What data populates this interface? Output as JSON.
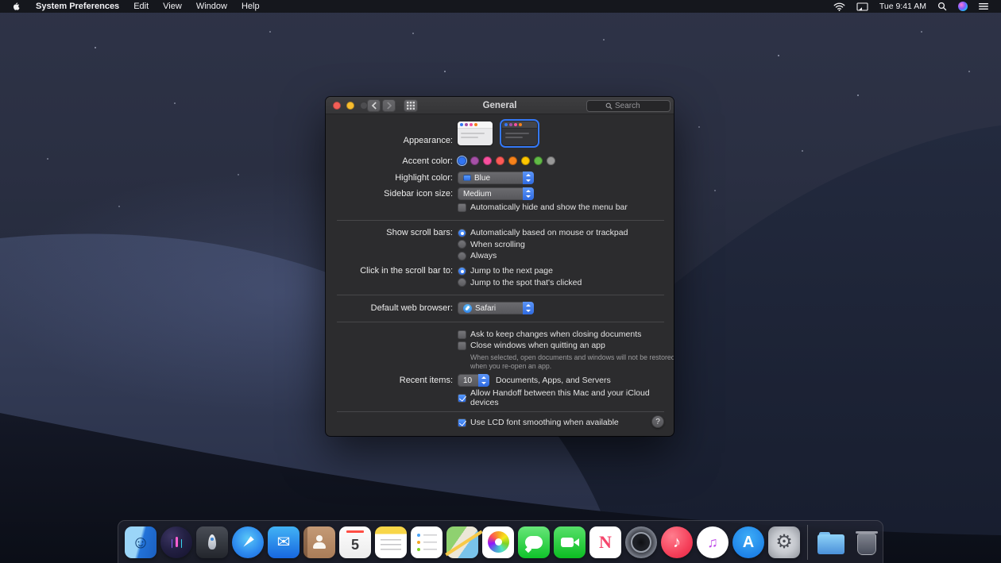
{
  "menu_bar": {
    "menus": [
      {
        "name": "menu-system-preferences",
        "label": "System Preferences",
        "class": "bold"
      },
      {
        "name": "menu-edit",
        "label": "Edit"
      },
      {
        "name": "menu-view",
        "label": "View"
      },
      {
        "name": "menu-window",
        "label": "Window"
      },
      {
        "name": "menu-help",
        "label": "Help"
      }
    ],
    "clock": "Tue 9:41 AM"
  },
  "window": {
    "title": "General",
    "search_placeholder": "Search",
    "rows": {
      "appearance": {
        "label": "Appearance:",
        "selected": "Dark"
      },
      "accent": {
        "label": "Accent color:",
        "selected": "Blue",
        "colors": [
          {
            "name": "accent-color-blue",
            "hex": "#3174f1",
            "state": "sel"
          },
          {
            "name": "accent-color-purple",
            "hex": "#a550a7",
            "state": ""
          },
          {
            "name": "accent-color-pink",
            "hex": "#f74f9e",
            "state": ""
          },
          {
            "name": "accent-color-red",
            "hex": "#fc5a57",
            "state": ""
          },
          {
            "name": "accent-color-orange",
            "hex": "#f7821b",
            "state": ""
          },
          {
            "name": "accent-color-yellow",
            "hex": "#fec600",
            "state": ""
          },
          {
            "name": "accent-color-green",
            "hex": "#61ba46",
            "state": ""
          },
          {
            "name": "accent-color-graphite",
            "hex": "#989898",
            "state": ""
          }
        ]
      },
      "highlight": {
        "label": "Highlight color:",
        "value": "Blue"
      },
      "sidebar_size": {
        "label": "Sidebar icon size:",
        "value": "Medium"
      },
      "hide_menu_bar": {
        "label": "Automatically hide and show the menu bar",
        "checked": false
      },
      "scroll_bars": {
        "label": "Show scroll bars:",
        "options": [
          {
            "name": "radio-scrollbars-automatic",
            "label": "Automatically based on mouse or trackpad",
            "state": "on"
          },
          {
            "name": "radio-scrollbars-when-scrolling",
            "label": "When scrolling",
            "state": ""
          },
          {
            "name": "radio-scrollbars-always",
            "label": "Always",
            "state": ""
          }
        ]
      },
      "click_scroll": {
        "label": "Click in the scroll bar to:",
        "options": [
          {
            "name": "radio-jump-next-page",
            "label": "Jump to the next page",
            "state": "on"
          },
          {
            "name": "radio-jump-to-spot",
            "label": "Jump to the spot that's clicked",
            "state": ""
          }
        ]
      },
      "browser": {
        "label": "Default web browser:",
        "value": "Safari"
      },
      "ask_keep": {
        "label": "Ask to keep changes when closing documents",
        "checked": false
      },
      "close_windows": {
        "label": "Close windows when quitting an app",
        "checked": false
      },
      "note": "When selected, open documents and windows will not be restored when you re-open an app.",
      "recent": {
        "label": "Recent items:",
        "value": "10",
        "suffix": "Documents, Apps, and Servers"
      },
      "handoff": {
        "label": "Allow Handoff between this Mac and your iCloud devices",
        "checked": true
      },
      "lcd": {
        "label": "Use LCD font smoothing when available",
        "checked": true
      }
    },
    "help_label": "?"
  },
  "dock": {
    "apps": [
      {
        "name": "dock-finder-icon",
        "tile_class": "",
        "bg": "linear-gradient(105deg,#9bd5f8 0%,#9bd5f8 46%,#2272d8 54%,#1b5fc0 100%)",
        "glyph": "☺",
        "fg": "#0d3a70",
        "glyph_class": "g22"
      },
      {
        "name": "dock-siri-icon",
        "tile_class": "circle",
        "bg": "radial-gradient(circle at 35% 30%,#3c3562 0%,#232043 45%,#14122c 100%)",
        "glyph": "",
        "fg": "",
        "glyph_class": "siri-wave"
      },
      {
        "name": "dock-launchpad-icon",
        "tile_class": "",
        "bg": "linear-gradient(180deg,#494d56,#23262c)",
        "glyph": "",
        "fg": "",
        "glyph_class": "rocket"
      },
      {
        "name": "dock-safari-icon",
        "tile_class": "circle",
        "bg": "radial-gradient(circle at 50% 38%,#5bc8f7 0%,#2f8df0 55%,#1763d8 100%)",
        "glyph": "",
        "fg": "",
        "glyph_class": "needle"
      },
      {
        "name": "dock-mail-icon",
        "tile_class": "",
        "bg": "linear-gradient(180deg,#42b3f5,#1767e0)",
        "glyph": "✉",
        "fg": "#ffffff",
        "glyph_class": "g20"
      },
      {
        "name": "dock-contacts-icon",
        "tile_class": "book",
        "bg": "linear-gradient(180deg,#c49a76,#a97c58)",
        "glyph": "",
        "fg": "",
        "glyph_class": "person"
      },
      {
        "name": "dock-calendar-icon",
        "tile_class": "cal",
        "bg": "linear-gradient(180deg,#fdfdfd,#ececec)",
        "glyph": "5",
        "fg": "#3a3a3c",
        "glyph_class": "g18 cal-num"
      },
      {
        "name": "dock-notes-icon",
        "tile_class": "notes",
        "bg": "linear-gradient(180deg,#f8d648 0%,#f8d648 24%,#ffffff 24%)",
        "glyph": "",
        "fg": "",
        "glyph_class": ""
      },
      {
        "name": "dock-reminders-icon",
        "tile_class": "rem",
        "bg": "#ffffff",
        "glyph": "",
        "fg": "",
        "glyph_class": ""
      },
      {
        "name": "dock-maps-icon",
        "tile_class": "maps",
        "bg": "linear-gradient(125deg,#8fd170 0%,#8fd170 38%,#ece7d8 38%,#ece7d8 62%,#79c3ea 62%)",
        "glyph": "",
        "fg": "",
        "glyph_class": ""
      },
      {
        "name": "dock-photos-icon",
        "tile_class": "photos",
        "bg": "#ffffff",
        "glyph": "",
        "fg": "",
        "glyph_class": ""
      },
      {
        "name": "dock-messages-icon",
        "tile_class": "msg",
        "bg": "linear-gradient(180deg,#67e679,#0fc32a)",
        "glyph": "",
        "fg": "",
        "glyph_class": ""
      },
      {
        "name": "dock-facetime-icon",
        "tile_class": "ft",
        "bg": "linear-gradient(180deg,#57e06a,#0cbd22)",
        "glyph": "",
        "fg": "",
        "glyph_class": ""
      },
      {
        "name": "dock-news-icon",
        "tile_class": "",
        "bg": "#ffffff",
        "glyph": "N",
        "fg": "#f5446b",
        "glyph_class": "g22 serif"
      },
      {
        "name": "dock-photo-booth-icon",
        "tile_class": "circle lens",
        "bg": "radial-gradient(circle,#0e0f13 0%,#23252c 35%,#7d828e 70%,#41454e 100%)",
        "glyph": "",
        "fg": "",
        "glyph_class": ""
      },
      {
        "name": "dock-music-icon",
        "tile_class": "circle",
        "bg": "radial-gradient(circle at 35% 30%,#ff7d8e,#f5405a 60%,#e02440)",
        "glyph": "♪",
        "fg": "#ffffff",
        "glyph_class": "g20"
      },
      {
        "name": "dock-itunes-icon",
        "tile_class": "circle",
        "bg": "#ffffff",
        "glyph": "♫",
        "fg": "#c050e8",
        "glyph_class": "g18"
      },
      {
        "name": "dock-app-store-icon",
        "tile_class": "circle",
        "bg": "radial-gradient(circle at 50% 35%,#3eaef7,#1272e2)",
        "glyph": "A",
        "fg": "#ffffff",
        "glyph_class": "g20 boldg"
      },
      {
        "name": "dock-system-preferences-icon",
        "tile_class": "",
        "bg": "radial-gradient(circle,#e2e4e8 0%,#c4c7cd 50%,#8f939b 100%)",
        "glyph": "⚙",
        "fg": "#4c4f57",
        "glyph_class": "g24"
      }
    ],
    "others": [
      {
        "name": "dock-downloads-folder-icon",
        "tile_class": "folder",
        "bg": "",
        "glyph": "",
        "fg": "",
        "glyph_class": ""
      },
      {
        "name": "dock-trash-icon",
        "tile_class": "trash",
        "bg": "",
        "glyph": "",
        "fg": "",
        "glyph_class": ""
      }
    ]
  }
}
